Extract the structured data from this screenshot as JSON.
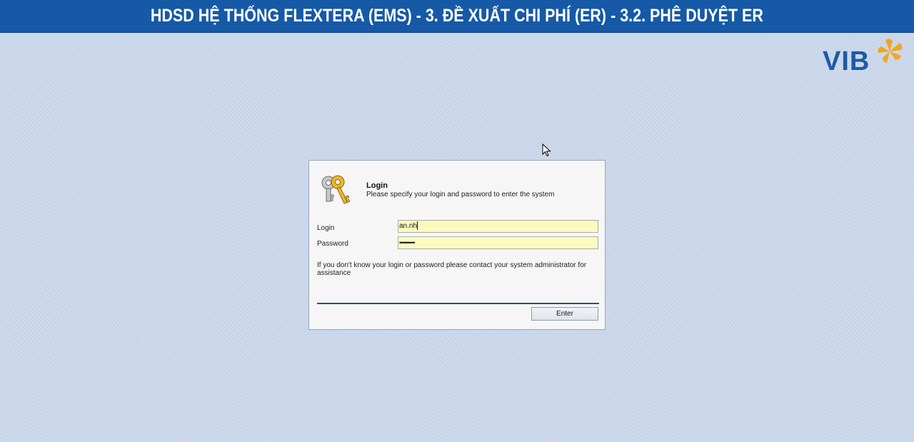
{
  "banner": {
    "title": "HDSD HỆ THỐNG FLEXTERA (EMS) - 3. ĐỀ XUẤT CHI PHÍ (ER) - 3.2. PHÊ DUYỆT ER"
  },
  "brand": {
    "logo_text": "VIB",
    "logo_color": "#1d5aa6",
    "accent_color": "#f2a51e"
  },
  "login_dialog": {
    "title": "Login",
    "subtitle": "Please specify your login and password to enter the system",
    "icon": "keys-icon",
    "login_label": "Login",
    "login_value": "an.nh",
    "password_label": "Password",
    "password_value": "••••••••••",
    "help_text": "If you don't know your login or password please contact your system administrator for assistance",
    "enter_label": "Enter"
  },
  "colors": {
    "banner_bg": "#1659a6",
    "page_bg": "#cad7ea",
    "input_bg": "#fcfbbf"
  }
}
